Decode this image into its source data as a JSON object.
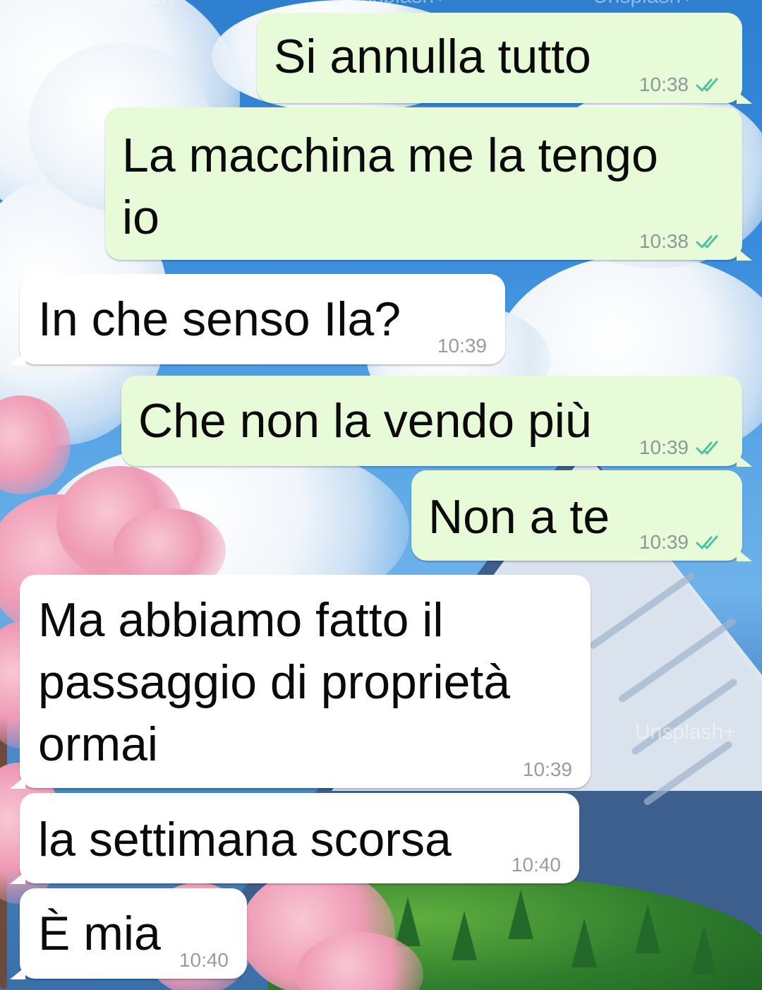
{
  "theme": {
    "outgoing_bubble": "#e7fbd9",
    "incoming_bubble": "#ffffff",
    "read_check_color": "#4fc3a1"
  },
  "wallpaper": {
    "watermark": "Unsplash+"
  },
  "messages": [
    {
      "direction": "outgoing",
      "text": "Si annulla tutto",
      "time": "10:38",
      "status": "read",
      "icon": "double-check-icon"
    },
    {
      "direction": "outgoing",
      "text_lines": [
        "La macchina me la tengo",
        "io"
      ],
      "time": "10:38",
      "status": "read",
      "icon": "double-check-icon"
    },
    {
      "direction": "incoming",
      "text": "In che senso Ila?",
      "time": "10:39"
    },
    {
      "direction": "outgoing",
      "text": "Che non la vendo più",
      "time": "10:39",
      "status": "read",
      "icon": "double-check-icon"
    },
    {
      "direction": "outgoing",
      "text": "Non a te",
      "time": "10:39",
      "status": "read",
      "icon": "double-check-icon"
    },
    {
      "direction": "incoming",
      "text_lines": [
        "Ma abbiamo fatto il",
        "passaggio di proprietà",
        "ormai"
      ],
      "time": "10:39"
    },
    {
      "direction": "incoming",
      "text": "la settimana scorsa",
      "time": "10:40"
    },
    {
      "direction": "incoming",
      "text": "È mia",
      "time": "10:40"
    }
  ]
}
